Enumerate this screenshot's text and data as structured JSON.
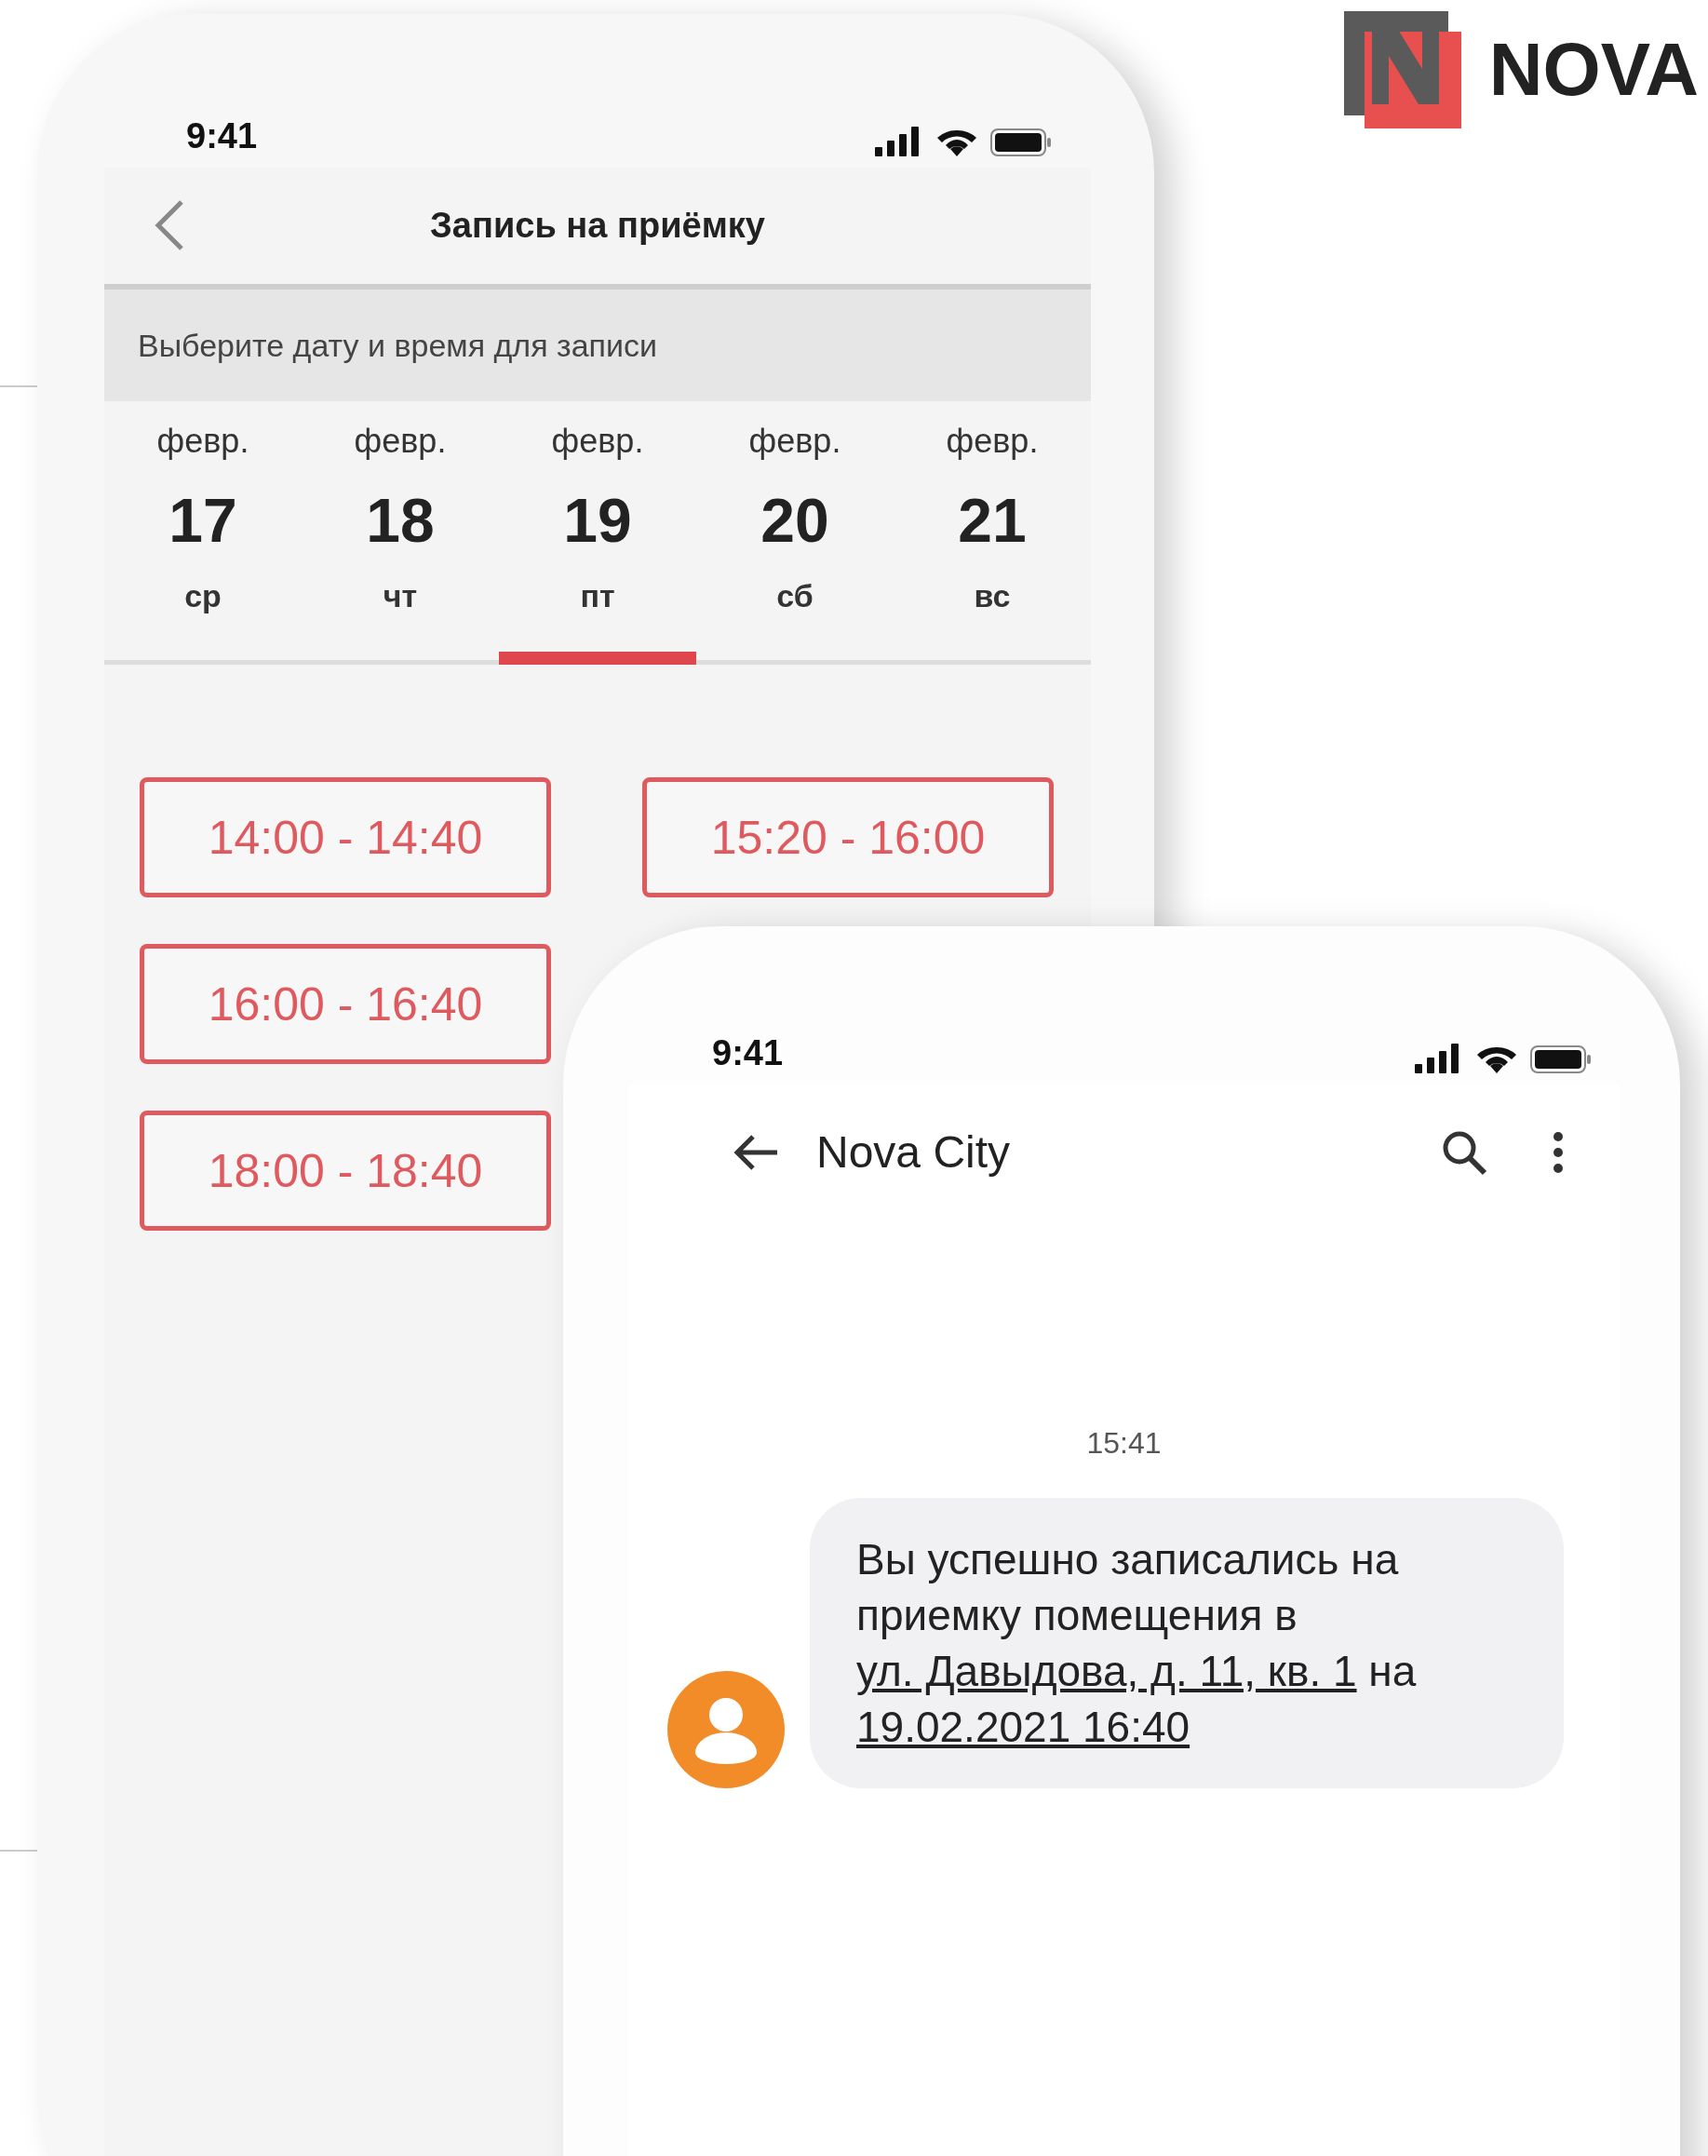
{
  "logo": {
    "text": "NOVA"
  },
  "booking_phone": {
    "status_bar": {
      "time": "9:41"
    },
    "header": {
      "title": "Запись на приёмку"
    },
    "prompt": "Выберите дату и время для записи",
    "dates": [
      {
        "month": "февр.",
        "day": "17",
        "weekday": "ср",
        "selected": false
      },
      {
        "month": "февр.",
        "day": "18",
        "weekday": "чт",
        "selected": false
      },
      {
        "month": "февр.",
        "day": "19",
        "weekday": "пт",
        "selected": true
      },
      {
        "month": "февр.",
        "day": "20",
        "weekday": "сб",
        "selected": false
      },
      {
        "month": "февр.",
        "day": "21",
        "weekday": "вс",
        "selected": false
      }
    ],
    "time_slots": [
      "14:00 - 14:40",
      "15:20 - 16:00",
      "16:00 - 16:40",
      "18:00 - 18:40"
    ]
  },
  "sms_phone": {
    "status_bar": {
      "time": "9:41"
    },
    "header": {
      "title": "Nova City"
    },
    "timestamp": "15:41",
    "message": {
      "parts": [
        {
          "kind": "text",
          "text": "Вы успешно записались на приемку помещения в "
        },
        {
          "kind": "link",
          "text": "ул. Давыдова, д. 11, кв. 1"
        },
        {
          "kind": "text",
          "text": " на "
        },
        {
          "kind": "link",
          "text": "19.02.2021 16:40"
        }
      ]
    }
  }
}
